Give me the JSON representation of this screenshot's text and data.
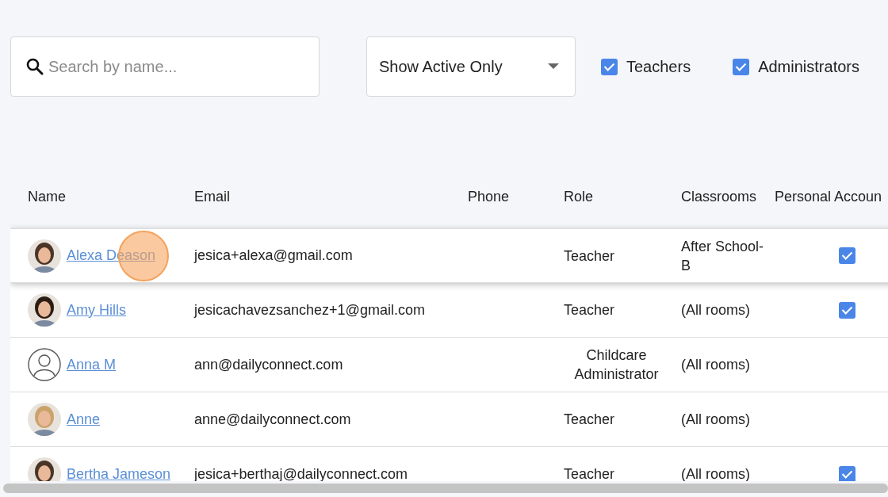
{
  "search": {
    "placeholder": "Search by name..."
  },
  "status_filter": {
    "value": "Show Active Only"
  },
  "role_filters": [
    {
      "label": "Teachers",
      "checked": true
    },
    {
      "label": "Administrators",
      "checked": true
    }
  ],
  "table": {
    "columns": [
      "Name",
      "Email",
      "Phone",
      "Role",
      "Classrooms",
      "Personal Accoun"
    ],
    "rows": [
      {
        "name": "Alexa Deason",
        "kind": "picture",
        "email": "jesica+alexa@gmail.com",
        "role": "Teacher",
        "classrooms": "After School-B",
        "personal_account": true,
        "highlighted": true,
        "clicked": true
      },
      {
        "name": "Amy Hills",
        "kind": "picture",
        "email": "jesicachavezsanchez+1@gmail.com",
        "role": "Teacher",
        "classrooms": "(All rooms)",
        "personal_account": true,
        "highlighted": false,
        "clicked": false
      },
      {
        "name": "Anna M",
        "kind": "placeholder",
        "email": "ann@dailyconnect.com",
        "role": "Childcare Administrator",
        "classrooms": "(All rooms)",
        "personal_account": false,
        "highlighted": false,
        "clicked": false
      },
      {
        "name": "Anne",
        "kind": "picture",
        "email": "anne@dailyconnect.com",
        "role": "Teacher",
        "classrooms": "(All rooms)",
        "personal_account": false,
        "highlighted": false,
        "clicked": false
      },
      {
        "name": "Bertha Jameson",
        "kind": "picture",
        "email": "jesica+berthaj@dailyconnect.com",
        "role": "Teacher",
        "classrooms": "(All rooms)",
        "personal_account": true,
        "highlighted": false,
        "clicked": false
      }
    ]
  }
}
